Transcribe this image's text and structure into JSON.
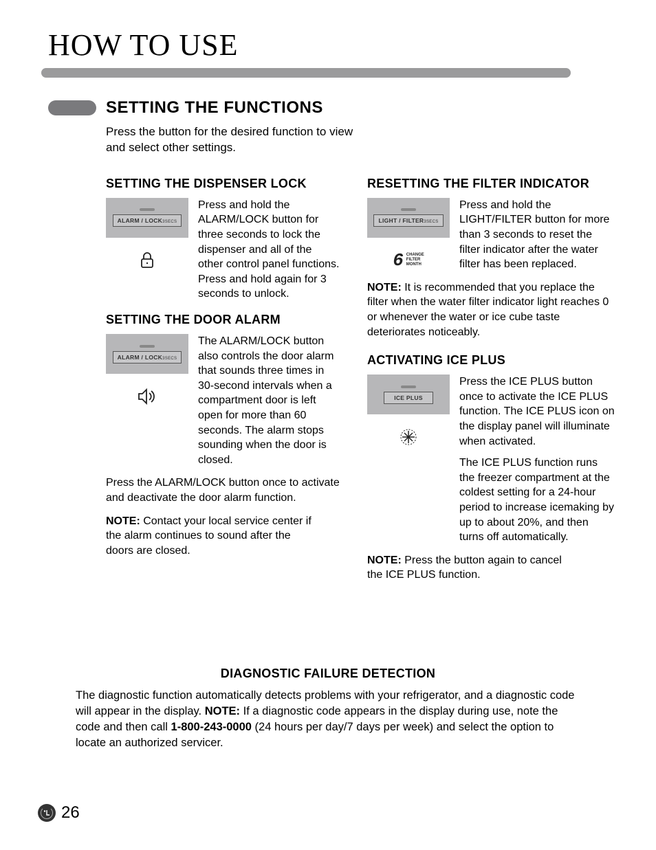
{
  "page": {
    "title": "HOW TO USE",
    "number": "26",
    "logo": "LG"
  },
  "section": {
    "title": "SETTING THE FUNCTIONS",
    "intro": "Press the button for the desired function to view and select other settings."
  },
  "dispenser_lock": {
    "title": "SETTING THE DISPENSER LOCK",
    "button_label": "ALARM / LOCK",
    "button_sub": "3SECS",
    "body": "Press and hold the ALARM/LOCK button for three seconds to lock the dispenser and all of the other control panel functions. Press and hold again for 3 seconds to unlock."
  },
  "door_alarm": {
    "title": "SETTING THE DOOR ALARM",
    "button_label": "ALARM / LOCK",
    "button_sub": "3SECS",
    "body": "The ALARM/LOCK button also controls the door alarm that sounds three times in 30-second intervals when a compartment door is  left open for more than 60 seconds. The alarm stops sounding when the door is closed.",
    "para2": "Press the ALARM/LOCK button once to activate and deactivate the door alarm function.",
    "note_label": "NOTE:",
    "note": " Contact your local service center if the alarm continues to sound after the doors are closed."
  },
  "filter": {
    "title": "RESETTING THE FILTER INDICATOR",
    "button_label": "LIGHT / FILTER",
    "button_sub": "3SECS",
    "digit": "6",
    "digit_l1": "CHANGE",
    "digit_l2": "FILTER",
    "digit_l3": "MONTH",
    "body": "Press and hold the LIGHT/FILTER button for more than 3 seconds to reset the filter indicator after the water filter has been replaced.",
    "note_label": "NOTE:",
    "note": " It is recommended that you replace the filter when the water filter indicator light reaches 0 or whenever the water or ice cube taste deteriorates noticeably."
  },
  "ice_plus": {
    "title": "ACTIVATING ICE PLUS",
    "button_label": "ICE PLUS",
    "body1": "Press the ICE PLUS button once to activate the ICE PLUS function. The ICE PLUS icon on the display panel will illuminate when activated.",
    "body2": "The ICE PLUS function runs the freezer compartment at the coldest setting for a 24-hour period to increase icemaking by up to about 20%, and then turns off automatically.",
    "note_label": "NOTE:",
    "note": " Press the button again to cancel the ICE PLUS function."
  },
  "diagnostic": {
    "title": "DIAGNOSTIC FAILURE DETECTION",
    "body_pre": "The diagnostic function automatically detects problems with your refrigerator, and a diagnostic code will appear in the display. ",
    "note_label": "NOTE:",
    "body_mid": " If a diagnostic code appears in the display during use, note the code and then call ",
    "phone": "1-800-243-0000",
    "body_post": " (24 hours per day/7 days per week) and select the option to locate an authorized servicer."
  }
}
